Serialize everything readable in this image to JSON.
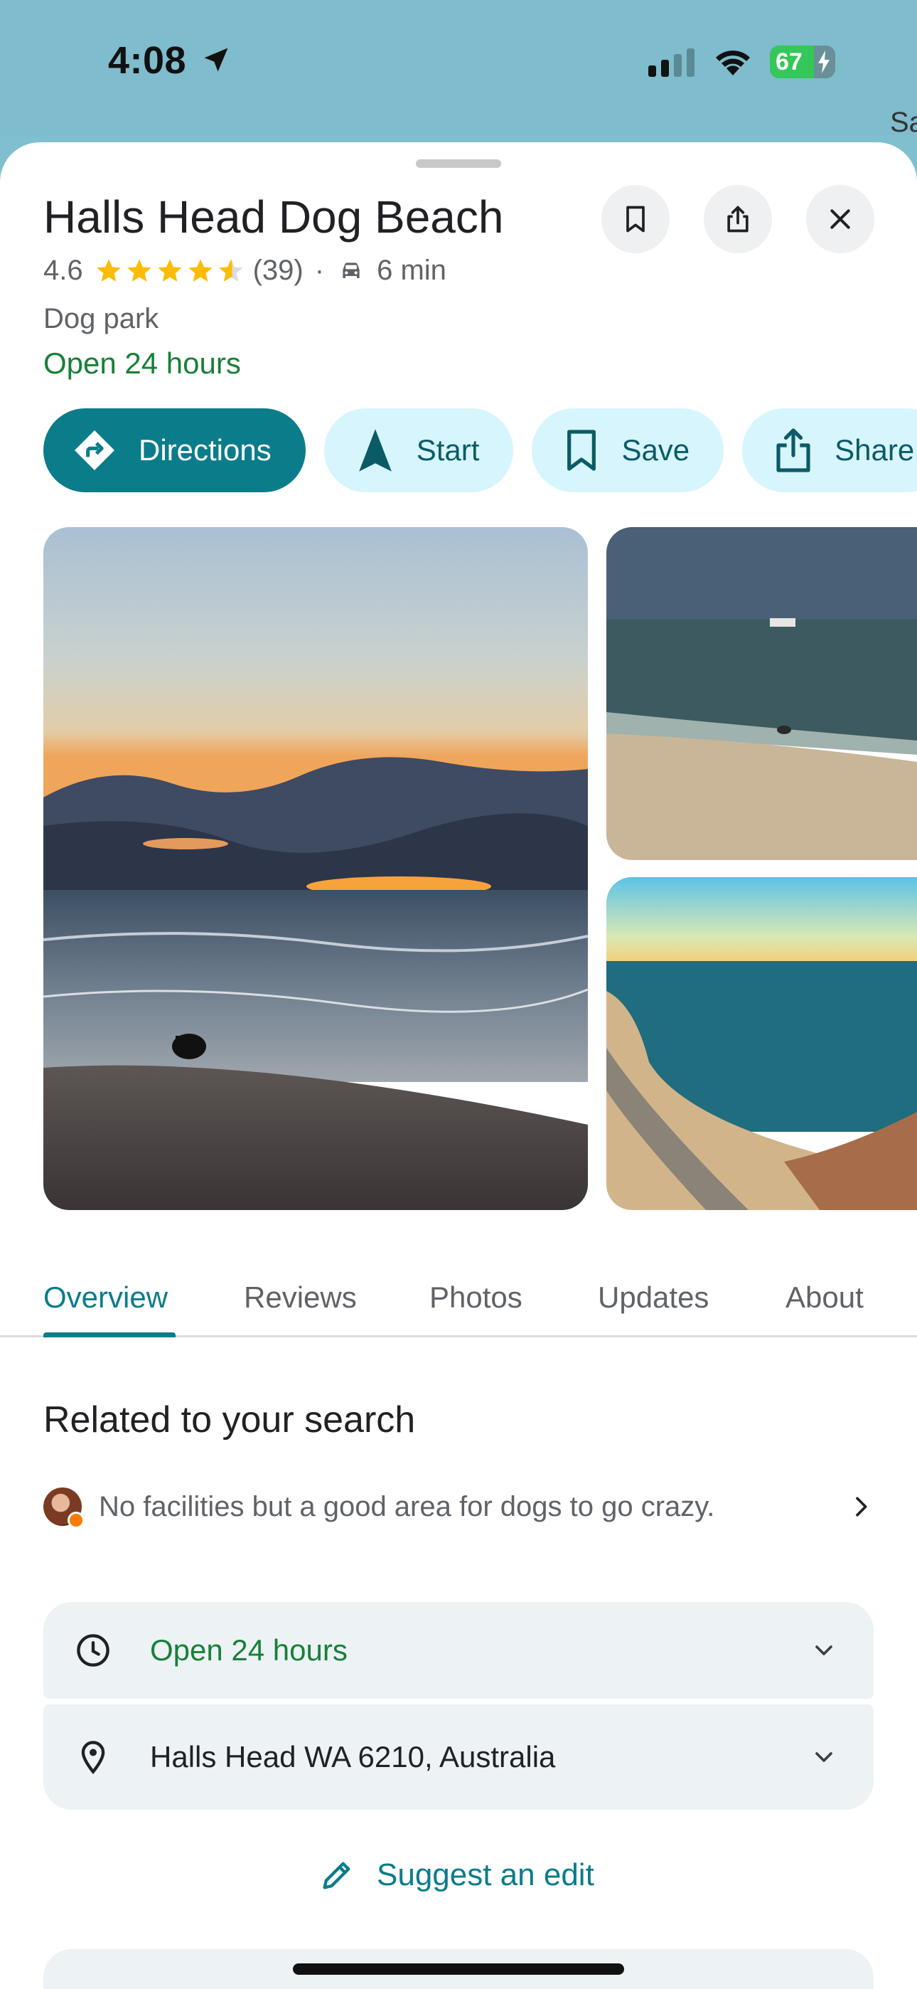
{
  "status_bar": {
    "time": "4:08",
    "battery": "67",
    "map_label": "Sa"
  },
  "place": {
    "name": "Halls Head Dog Beach",
    "rating": "4.6",
    "stars_value": 4.6,
    "review_count": "(39)",
    "separator": "·",
    "drive_time": "6 min",
    "category": "Dog park",
    "open_status": "Open 24 hours"
  },
  "header_buttons": {
    "save_icon": "bookmark-icon",
    "share_icon": "share-icon",
    "close_icon": "close-icon"
  },
  "actions": [
    {
      "label": "Directions",
      "icon": "directions-icon"
    },
    {
      "label": "Start",
      "icon": "navigation-arrow-icon"
    },
    {
      "label": "Save",
      "icon": "bookmark-icon"
    },
    {
      "label": "Share",
      "icon": "share-icon"
    }
  ],
  "tabs": [
    "Overview",
    "Reviews",
    "Photos",
    "Updates",
    "About"
  ],
  "active_tab": "Overview",
  "related": {
    "title": "Related to your search",
    "snippet": "No facilities but a good area for dogs to go crazy."
  },
  "info": {
    "hours": "Open 24 hours",
    "address": "Halls Head WA 6210, Australia"
  },
  "suggest_edit": "Suggest an edit",
  "colors": {
    "accent": "#0b7c8a",
    "open_green": "#188038",
    "chip_bg": "#d7f5fc",
    "star": "#fbbc04"
  }
}
